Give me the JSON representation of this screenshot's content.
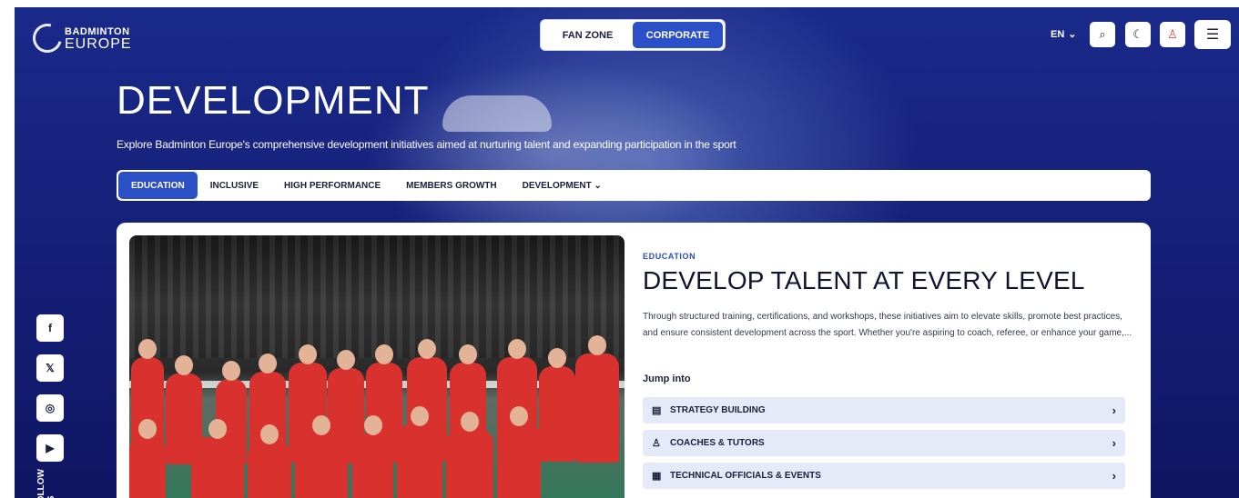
{
  "brand": {
    "line1": "BADMINTON",
    "line2": "EUROPE"
  },
  "switcher": [
    {
      "label": "FAN ZONE"
    },
    {
      "label": "CORPORATE"
    }
  ],
  "header": {
    "lang": "EN",
    "lang_chevron": "⌄",
    "search_icon": "⌕",
    "theme_icon": "☾",
    "user_icon": "♙",
    "menu_icon": "☰"
  },
  "page": {
    "title": "DEVELOPMENT",
    "description": "Explore Badminton Europe's comprehensive development initiatives aimed at nurturing talent and expanding participation in the sport"
  },
  "tabs": [
    {
      "label": "EDUCATION"
    },
    {
      "label": "INCLUSIVE"
    },
    {
      "label": "HIGH PERFORMANCE"
    },
    {
      "label": "MEMBERS GROWTH"
    },
    {
      "label": "DEVELOPMENT ⌄"
    }
  ],
  "social": [
    {
      "icon": "facebook-icon",
      "glyph": "f"
    },
    {
      "icon": "x-icon",
      "glyph": "𝕏"
    },
    {
      "icon": "instagram-icon",
      "glyph": "◎"
    },
    {
      "icon": "youtube-icon",
      "glyph": "▶"
    }
  ],
  "follow_text": "FOLLOW US",
  "card": {
    "eyebrow": "EDUCATION",
    "title": "DEVELOP TALENT AT EVERY LEVEL",
    "text": "Through structured training, certifications, and workshops, these initiatives aim to elevate skills, promote best practices, and ensure consistent development across the sport. Whether you're aspiring to coach, referee, or enhance your game,...",
    "jump_label": "Jump into",
    "jump_items": [
      {
        "label": "STRATEGY BUILDING",
        "icon": "▤"
      },
      {
        "label": "COACHES & TUTORS",
        "icon": "♙"
      },
      {
        "label": "TECHNICAL OFFICIALS & EVENTS",
        "icon": "▦"
      }
    ],
    "chevron": "›"
  },
  "colors": {
    "accent": "#2b4fc7",
    "hero": "#15207a",
    "jersey": "#d9322e"
  }
}
